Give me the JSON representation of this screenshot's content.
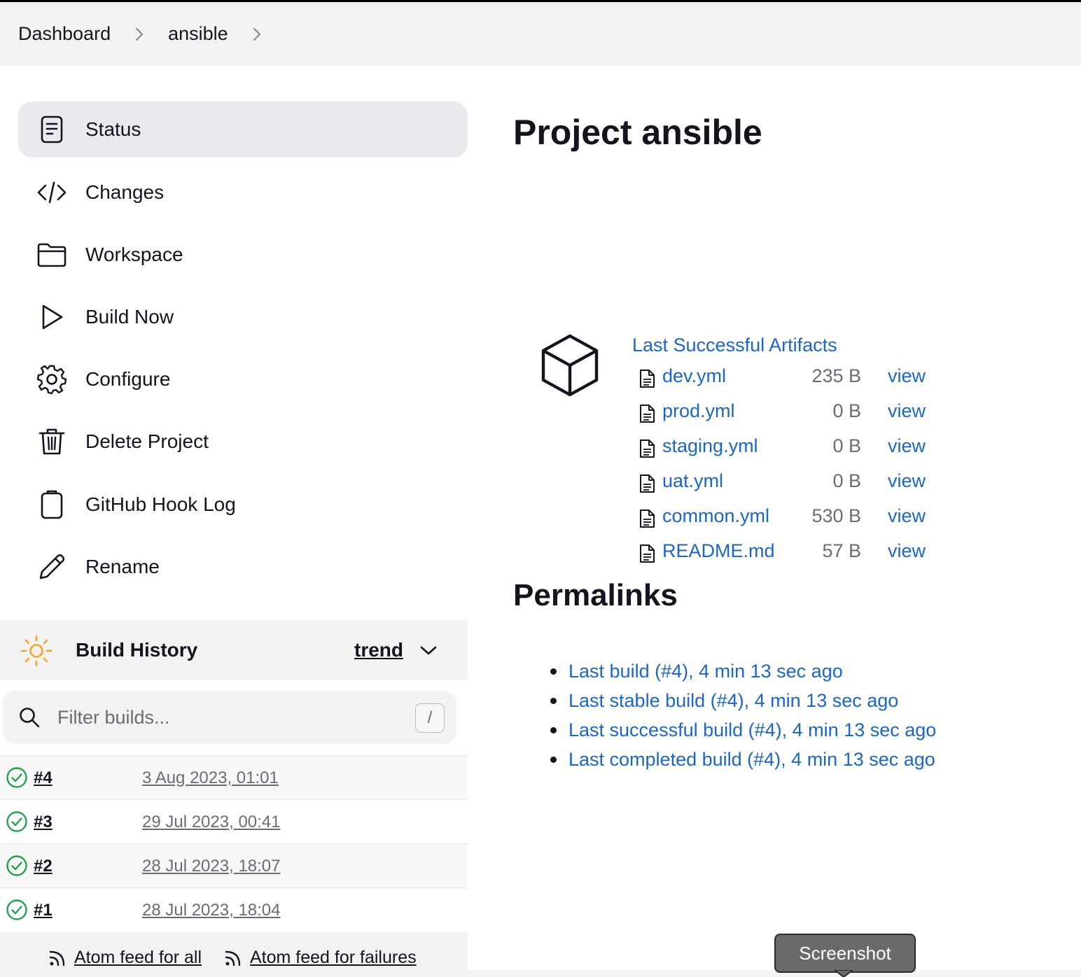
{
  "breadcrumb": {
    "items": [
      "Dashboard",
      "ansible"
    ]
  },
  "sidebar": {
    "tasks": [
      {
        "label": "Status",
        "icon": "status-document-icon",
        "active": true
      },
      {
        "label": "Changes",
        "icon": "code-icon",
        "active": false
      },
      {
        "label": "Workspace",
        "icon": "folder-icon",
        "active": false
      },
      {
        "label": "Build Now",
        "icon": "play-icon",
        "active": false
      },
      {
        "label": "Configure",
        "icon": "gear-icon",
        "active": false
      },
      {
        "label": "Delete Project",
        "icon": "trash-icon",
        "active": false
      },
      {
        "label": "GitHub Hook Log",
        "icon": "clipboard-icon",
        "active": false
      },
      {
        "label": "Rename",
        "icon": "pencil-icon",
        "active": false
      }
    ]
  },
  "build_history": {
    "title": "Build History",
    "trend_label": "trend",
    "filter_placeholder": "Filter builds...",
    "filter_shortcut": "/",
    "builds": [
      {
        "number": "#4",
        "date": "3 Aug 2023, 01:01",
        "status": "success"
      },
      {
        "number": "#3",
        "date": "29 Jul 2023, 00:41",
        "status": "success"
      },
      {
        "number": "#2",
        "date": "28 Jul 2023, 18:07",
        "status": "success"
      },
      {
        "number": "#1",
        "date": "28 Jul 2023, 18:04",
        "status": "success"
      }
    ],
    "feeds": {
      "all": "Atom feed for all",
      "failures": "Atom feed for failures"
    }
  },
  "main": {
    "title": "Project ansible",
    "artifacts": {
      "title": "Last Successful Artifacts",
      "files": [
        {
          "name": "dev.yml",
          "size": "235 B",
          "action": "view"
        },
        {
          "name": "prod.yml",
          "size": "0 B",
          "action": "view"
        },
        {
          "name": "staging.yml",
          "size": "0 B",
          "action": "view"
        },
        {
          "name": "uat.yml",
          "size": "0 B",
          "action": "view"
        },
        {
          "name": "common.yml",
          "size": "530 B",
          "action": "view"
        },
        {
          "name": "README.md",
          "size": "57 B",
          "action": "view"
        }
      ]
    },
    "permalinks": {
      "title": "Permalinks",
      "links": [
        "Last build (#4), 4 min 13 sec ago",
        "Last stable build (#4), 4 min 13 sec ago",
        "Last successful build (#4), 4 min 13 sec ago",
        "Last completed build (#4), 4 min 13 sec ago"
      ]
    }
  },
  "tooltip": {
    "text": "Screenshot"
  },
  "colors": {
    "link": "#1a66c9",
    "success": "#1ea446",
    "sun": "#f5a524",
    "active_bg": "#eaeaee"
  }
}
